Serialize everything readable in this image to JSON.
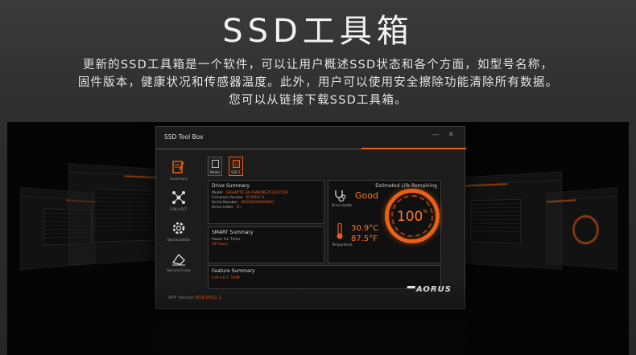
{
  "hero": {
    "title": "SSD工具箱",
    "line1": "更新的SSD工具箱是一个软件，可以让用户概述SSD状态和各个方面，如型号名称，",
    "line2": "固件版本，健康状况和传感器温度。此外，用户可以使用安全擦除功能清除所有数据。",
    "line3": "您可以从链接下载SSD工具箱。"
  },
  "app": {
    "window_title": "SSD Tool Box",
    "controls": "— ✕",
    "nav": [
      {
        "label": "Summary",
        "icon": "summary-icon"
      },
      {
        "label": "S.M.A.R.T.",
        "icon": "smart-network-icon"
      },
      {
        "label": "Optimization",
        "icon": "optimization-gear-icon"
      },
      {
        "label": "Secure Erase",
        "icon": "secure-erase-icon"
      }
    ],
    "tabs": [
      {
        "label": "Model",
        "active": false
      },
      {
        "label": "SSD 1",
        "active": true
      }
    ],
    "drive_summary": {
      "title": "Drive Summary",
      "rows": [
        {
          "label": "Model",
          "value": "GIGABYTE GP-ASM2NE2512GTTDR"
        },
        {
          "label": "Firmware Version",
          "value": "ECFM12.0"
        },
        {
          "label": "Serial Number",
          "value": "SN1930X0000000"
        },
        {
          "label": "Drive Letter",
          "value": "D:\\"
        }
      ]
    },
    "health": {
      "label": "Drive Health",
      "value": "Good"
    },
    "life": {
      "title": "Estimated Life Remaining",
      "value": "100",
      "unit": "%"
    },
    "temperature": {
      "label": "Temperature",
      "celsius": "30.9°C",
      "fahrenheit": "87.5°F"
    },
    "smart_summary": {
      "title": "SMART Summary",
      "row_label": "Power On Timer",
      "row_value": "29 hours"
    },
    "feature_summary": {
      "title": "Feature Summary",
      "row": "S.M.A.R.T.  TRIM"
    },
    "version": {
      "label": "APP Version",
      "value": "B19.0522.1"
    },
    "brand": "AORUS"
  },
  "colors": {
    "accent": "#e8601a",
    "background": "#050505",
    "window": "#1c1c1c"
  }
}
